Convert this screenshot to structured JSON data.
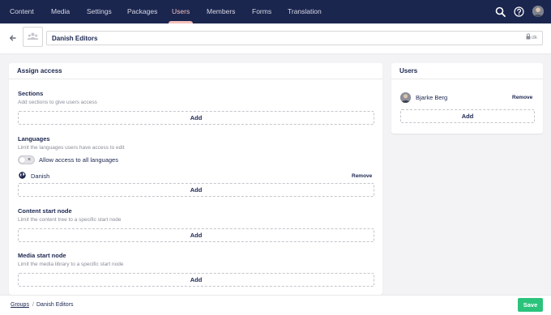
{
  "nav": {
    "items": [
      {
        "label": "Content",
        "active": false
      },
      {
        "label": "Media",
        "active": false
      },
      {
        "label": "Settings",
        "active": false
      },
      {
        "label": "Packages",
        "active": false
      },
      {
        "label": "Users",
        "active": true
      },
      {
        "label": "Members",
        "active": false
      },
      {
        "label": "Forms",
        "active": false
      },
      {
        "label": "Translation",
        "active": false
      }
    ],
    "icons": [
      "search-icon",
      "help-icon",
      "user-avatar"
    ]
  },
  "header": {
    "group_name": "Danish Editors",
    "alias": "dk"
  },
  "assign_access": {
    "title": "Assign access",
    "sections": {
      "title": "Sections",
      "description": "Add sections to give users access",
      "add_label": "Add"
    },
    "languages": {
      "title": "Languages",
      "description": "Limit the languages users have access to edit",
      "toggle_label": "Allow access to all languages",
      "toggle_on": false,
      "items": [
        {
          "name": "Danish",
          "remove_label": "Remove"
        }
      ],
      "add_label": "Add"
    },
    "content_start_node": {
      "title": "Content start node",
      "description": "Limit the content tree to a specific start node",
      "add_label": "Add"
    },
    "media_start_node": {
      "title": "Media start node",
      "description": "Limit the media library to a specific start node",
      "add_label": "Add"
    }
  },
  "users_panel": {
    "title": "Users",
    "users": [
      {
        "name": "Bjarke Berg",
        "remove_label": "Remove"
      }
    ],
    "add_label": "Add"
  },
  "footer": {
    "breadcrumb": [
      {
        "label": "Groups",
        "link": true
      },
      {
        "label": "Danish Editors",
        "link": false
      }
    ],
    "separator": "/",
    "save_label": "Save"
  },
  "colors": {
    "nav_bg": "#1b264f",
    "active_accent": "#f5c1bc",
    "save_green": "#2bc37c",
    "page_bg": "#f3f3f5"
  }
}
